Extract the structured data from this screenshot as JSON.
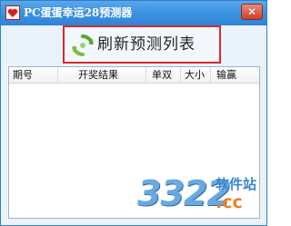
{
  "window": {
    "title": "PC蛋蛋幸运28预测器",
    "close_label": "✕"
  },
  "toolbar": {
    "refresh_label": "刷新预测列表"
  },
  "list": {
    "columns": [
      "期号",
      "开奖结果",
      "单双",
      "大小",
      "输赢"
    ]
  },
  "watermark": {
    "digits": "3322",
    "site": "软件站",
    "domain": ".cc"
  },
  "colors": {
    "titlebar": "#3f93e2",
    "highlight_border": "#e0262c",
    "refresh_icon": "#5aa832"
  },
  "icons": {
    "app": "heart-icon",
    "refresh": "refresh-icon",
    "close": "close-icon"
  }
}
